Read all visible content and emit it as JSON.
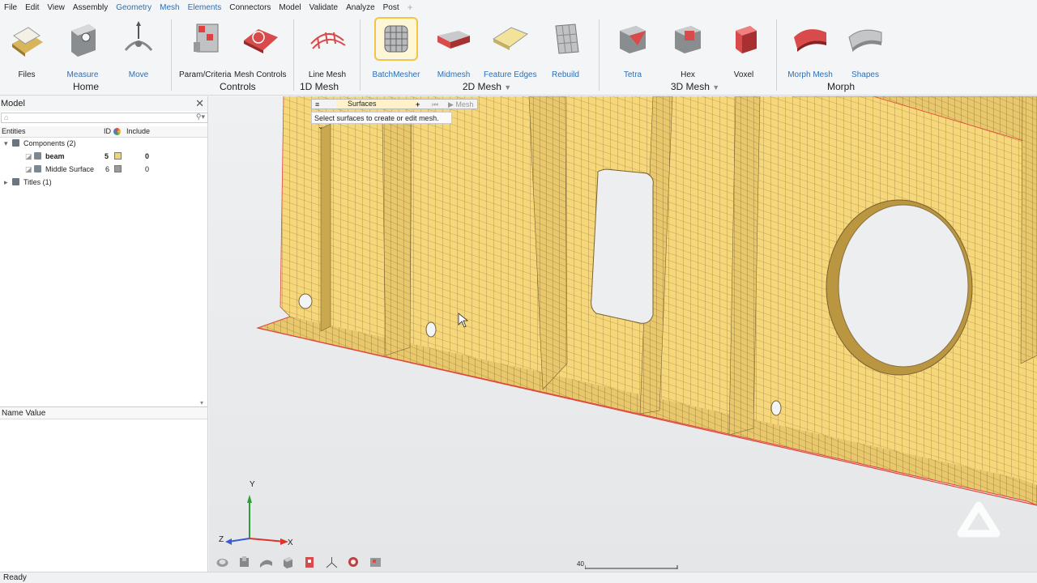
{
  "menu": [
    "File",
    "Edit",
    "View",
    "Assembly",
    "Geometry",
    "Mesh",
    "Elements",
    "Connectors",
    "Model",
    "Validate",
    "Analyze",
    "Post"
  ],
  "ribbon": {
    "tools": {
      "files": "Files",
      "measure": "Measure",
      "move": "Move",
      "param_criteria": "Param/Criteria",
      "mesh_controls": "Mesh Controls",
      "line_mesh": "Line Mesh",
      "batchmesher": "BatchMesher",
      "midmesh": "Midmesh",
      "feature_edges": "Feature Edges",
      "rebuild": "Rebuild",
      "tetra": "Tetra",
      "hex": "Hex",
      "voxel": "Voxel",
      "morph_mesh": "Morph Mesh",
      "shapes": "Shapes"
    },
    "groups": {
      "home": "Home",
      "controls": "Controls",
      "mesh1d": "1D Mesh",
      "mesh2d": "2D Mesh",
      "mesh3d": "3D Mesh",
      "morph": "Morph"
    }
  },
  "panel": {
    "title": "Model",
    "columns": {
      "entities": "Entities",
      "id": "ID",
      "include": "Include"
    },
    "components_label": "Components (2)",
    "items": [
      {
        "name": "beam",
        "id": "5",
        "include": "0",
        "color": "#f2d27a"
      },
      {
        "name": "Middle Surface",
        "id": "6",
        "include": "0",
        "color": "#9a9a9a"
      }
    ],
    "titles_label": "Titles (1)",
    "name_value_header": "Name Value"
  },
  "mesh_toolbar": {
    "surfaces": "Surfaces",
    "mesh": "Mesh",
    "hint": "Select surfaces to create or edit mesh."
  },
  "triad": {
    "y": "Y",
    "z": "Z",
    "x": "X"
  },
  "scale_value": "40",
  "status": "Ready",
  "colors": {
    "mesh_face": "#f6d77a",
    "mesh_line": "#8a7240",
    "edge_red": "#e0463a",
    "accent_blue": "#2a6fb8"
  }
}
